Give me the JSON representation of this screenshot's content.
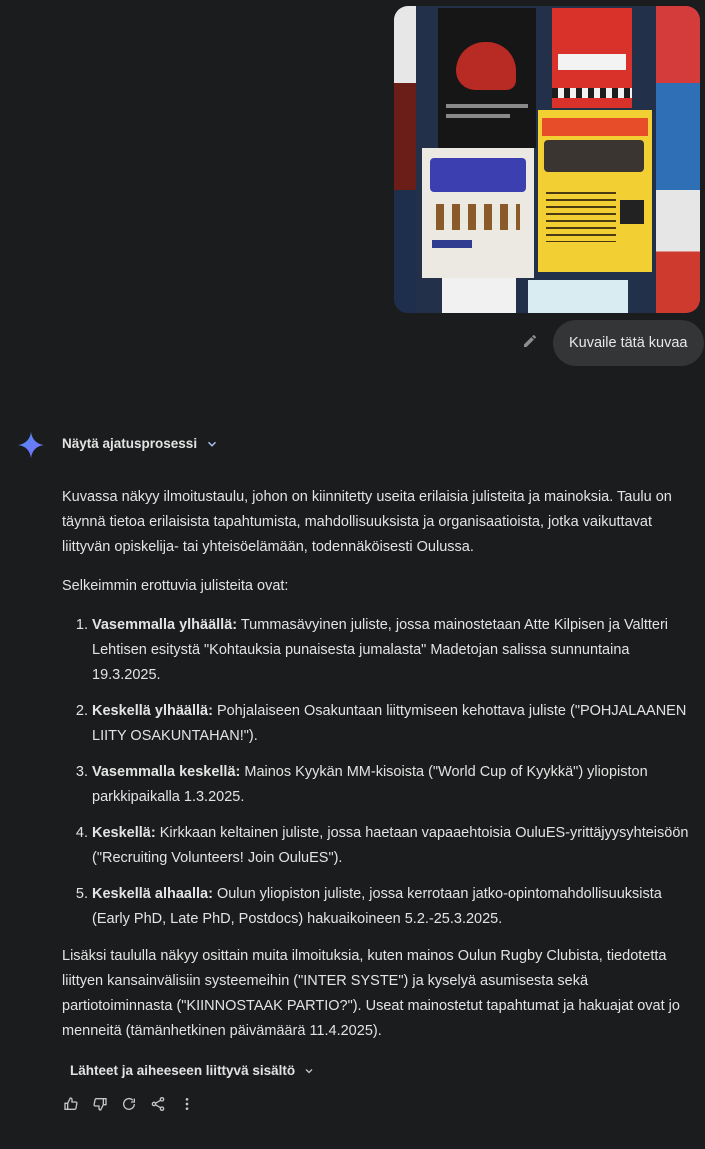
{
  "user_message": {
    "text": "Kuvaile tätä kuvaa"
  },
  "photo": {
    "poster_texts": [
      "Kohtauksia punaisesta jumalasta",
      "LIITY OSAKUNTAAN",
      "World Cup of Kyykkä",
      "1.3.2025",
      "Recruiting Volunteers!",
      "INTER SYSTE",
      "5.2.-25.3.2025"
    ]
  },
  "response": {
    "thinking_toggle": "Näytä ajatusprosessi",
    "intro": "Kuvassa näkyy ilmoitustaulu, johon on kiinnitetty useita erilaisia julisteita ja mainoksia. Taulu on täynnä tietoa erilaisista tapahtumista, mahdollisuuksista ja organisaatioista, jotka vaikuttavat liittyvän opiskelija- tai yhteisöelämään, todennäköisesti Oulussa.",
    "list_heading": "Selkeimmin erottuvia julisteita ovat:",
    "items": [
      {
        "bold": "Vasemmalla ylhäällä:",
        "text": " Tummasävyinen juliste, jossa mainostetaan Atte Kilpisen ja Valtteri Lehtisen esitystä \"Kohtauksia punaisesta jumalasta\" Madetojan salissa sunnuntaina 19.3.2025."
      },
      {
        "bold": "Keskellä ylhäällä:",
        "text": " Pohjalaiseen Osakuntaan liittymiseen kehottava juliste (\"POHJALAANEN LIITY OSAKUNTAHAN!\")."
      },
      {
        "bold": "Vasemmalla keskellä:",
        "text": " Mainos Kyykän MM-kisoista (\"World Cup of Kyykkä\") yliopiston parkkipaikalla 1.3.2025."
      },
      {
        "bold": "Keskellä:",
        "text": " Kirkkaan keltainen juliste, jossa haetaan vapaaehtoisia OuluES-yrittäjyysyhteisöön (\"Recruiting Volunteers! Join OuluES\")."
      },
      {
        "bold": "Keskellä alhaalla:",
        "text": " Oulun yliopiston juliste, jossa kerrotaan jatko-opintomahdollisuuksista (Early PhD, Late PhD, Postdocs) hakuaikoineen 5.2.-25.3.2025."
      }
    ],
    "outro": "Lisäksi taululla näkyy osittain muita ilmoituksia, kuten mainos Oulun Rugby Clubista, tiedotetta liittyen kansainvälisiin systeemeihin (\"INTER SYSTE\") ja kyselyä asumisesta sekä partiotoiminnasta (\"KIINNOSTAAK PARTIO?\"). Useat mainostetut tapahtumat ja hakuajat ovat jo menneitä (tämänhetkinen päivämäärä 11.4.2025).",
    "sources_label": "Lähteet ja aiheeseen liittyvä sisältö"
  },
  "icons": [
    "edit-icon",
    "gemini-spark-icon",
    "chevron-down-icon",
    "thumb-up-icon",
    "thumb-down-icon",
    "regenerate-icon",
    "share-icon",
    "more-vert-icon"
  ],
  "colors": {
    "background": "#1b1c1d",
    "bubble": "#333537",
    "accent": "#a8c7fa",
    "text": "#e3e3e3"
  }
}
